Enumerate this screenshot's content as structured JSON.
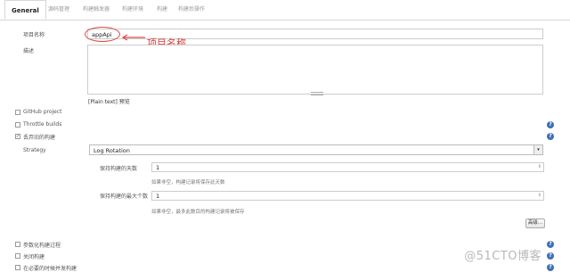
{
  "tabs": [
    "General",
    "源码管理",
    "构建触发器",
    "构建环境",
    "构建",
    "构建后操作"
  ],
  "fields": {
    "project_name_label": "项目名称",
    "project_name_value": "appApi",
    "description_label": "描述",
    "preview_text": "[Plain text] 预览"
  },
  "annotation": "项目名称",
  "options": {
    "github_project": "GitHub project",
    "throttle_builds": "Throttle builds",
    "discard_old_builds": "丢弃旧的构建",
    "parameterized": "参数化构建过程",
    "disable_build": "关闭构建",
    "concurrent": "在必要的时候并发构建"
  },
  "strategy": {
    "label": "Strategy",
    "value": "Log Rotation",
    "days_label": "保持构建的天数",
    "days_value": "1",
    "days_hint": "如果非空，构建记录将保存此天数",
    "max_label": "保持构建的最大个数",
    "max_value": "1",
    "max_hint": "如果非空，最多此数目的构建记录将被保存",
    "advanced_button": "高级..."
  },
  "watermark": "@51CTO博客",
  "help_glyph": "?",
  "check_glyph": "✓",
  "dropdown_glyph": "▾",
  "spinner_glyph": "⇕"
}
